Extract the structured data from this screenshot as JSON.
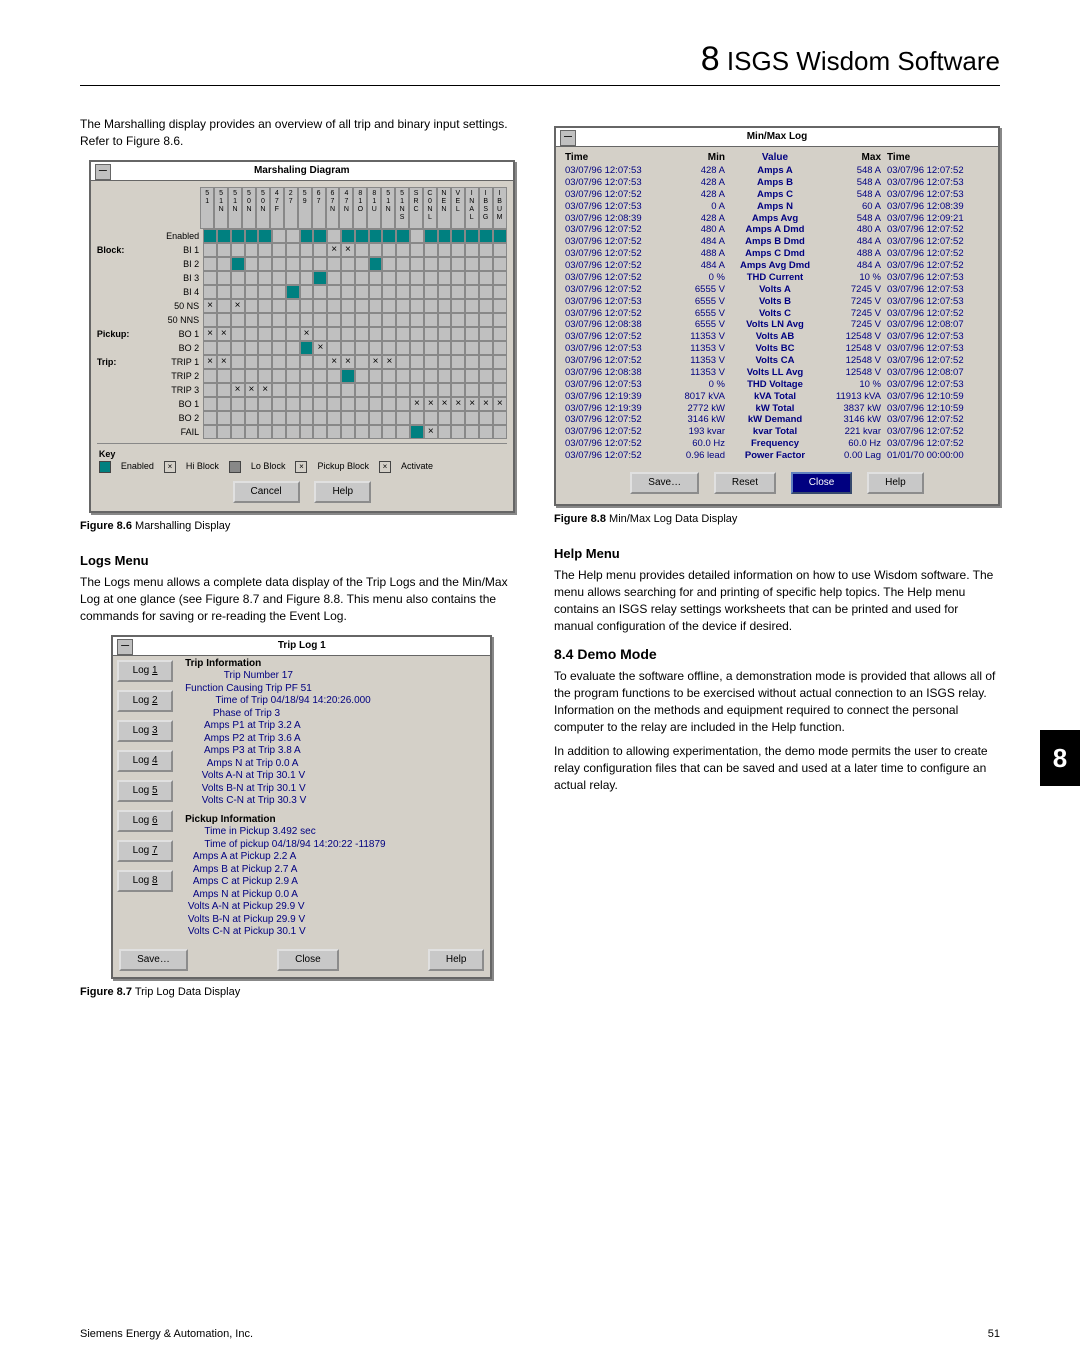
{
  "chapter": {
    "num": "8",
    "title": "ISGS Wisdom Software"
  },
  "side_tab": "8",
  "left": {
    "intro": "The Marshalling display provides an overview of all trip and binary input settings. Refer to Figure 8.6.",
    "marsh_caption_b": "Figure 8.6",
    "marsh_caption": "Marshalling Display",
    "marsh_dialog_title": "Marshaling Diagram",
    "marsh_col_headers": [
      "5 1",
      "5 1 N",
      "5 1 N",
      "5 0 N",
      "5 0 N",
      "4 7 F",
      "2 7",
      "5 9",
      "6 7",
      "6 7 N",
      "4 7 N",
      "8 1 O",
      "8 1 U",
      "5 1 N",
      "5 1 N S",
      "S R C",
      "C 0 N L",
      "N E N",
      "V E L",
      "I N A L",
      "I B S G",
      "I B U M"
    ],
    "marsh_sections": [
      {
        "label": "",
        "rows": [
          {
            "name": "Enabled",
            "cells": [
              1,
              1,
              1,
              1,
              1,
              0,
              0,
              1,
              1,
              0,
              1,
              1,
              1,
              1,
              1,
              0,
              1,
              1,
              1,
              1,
              1,
              1
            ]
          }
        ]
      },
      {
        "label": "Block:",
        "rows": [
          {
            "name": "BI 1",
            "cells": [
              0,
              0,
              0,
              0,
              0,
              0,
              0,
              0,
              0,
              2,
              2,
              0,
              0,
              0,
              0,
              0,
              0,
              0,
              0,
              0,
              0,
              0
            ]
          },
          {
            "name": "BI 2",
            "cells": [
              0,
              0,
              1,
              0,
              0,
              0,
              0,
              0,
              0,
              0,
              0,
              0,
              1,
              0,
              0,
              0,
              0,
              0,
              0,
              0,
              0,
              0
            ]
          },
          {
            "name": "BI 3",
            "cells": [
              0,
              0,
              0,
              0,
              0,
              0,
              0,
              0,
              1,
              0,
              0,
              0,
              0,
              0,
              0,
              0,
              0,
              0,
              0,
              0,
              0,
              0
            ]
          },
          {
            "name": "BI 4",
            "cells": [
              0,
              0,
              0,
              0,
              0,
              0,
              1,
              0,
              0,
              0,
              0,
              0,
              0,
              0,
              0,
              0,
              0,
              0,
              0,
              0,
              0,
              0
            ]
          },
          {
            "name": "50 NS",
            "cells": [
              2,
              0,
              2,
              0,
              0,
              0,
              0,
              0,
              0,
              0,
              0,
              0,
              0,
              0,
              0,
              0,
              0,
              0,
              0,
              0,
              0,
              0
            ]
          },
          {
            "name": "50 NNS",
            "cells": [
              0,
              0,
              0,
              0,
              0,
              0,
              0,
              0,
              0,
              0,
              0,
              0,
              0,
              0,
              0,
              0,
              0,
              0,
              0,
              0,
              0,
              0
            ]
          }
        ]
      },
      {
        "label": "Pickup:",
        "rows": [
          {
            "name": "BO 1",
            "cells": [
              2,
              2,
              0,
              0,
              0,
              0,
              0,
              2,
              0,
              0,
              0,
              0,
              0,
              0,
              0,
              0,
              0,
              0,
              0,
              0,
              0,
              0
            ]
          },
          {
            "name": "BO 2",
            "cells": [
              0,
              0,
              0,
              0,
              0,
              0,
              0,
              1,
              2,
              0,
              0,
              0,
              0,
              0,
              0,
              0,
              0,
              0,
              0,
              0,
              0,
              0
            ]
          }
        ]
      },
      {
        "label": "Trip:",
        "rows": [
          {
            "name": "TRIP 1",
            "cells": [
              2,
              2,
              0,
              0,
              0,
              0,
              0,
              0,
              0,
              2,
              2,
              0,
              2,
              2,
              0,
              0,
              0,
              0,
              0,
              0,
              0,
              0
            ]
          },
          {
            "name": "TRIP 2",
            "cells": [
              0,
              0,
              0,
              0,
              0,
              0,
              0,
              0,
              0,
              0,
              1,
              0,
              0,
              0,
              0,
              0,
              0,
              0,
              0,
              0,
              0,
              0
            ]
          },
          {
            "name": "TRIP 3",
            "cells": [
              0,
              0,
              2,
              2,
              2,
              0,
              0,
              0,
              0,
              0,
              0,
              0,
              0,
              0,
              0,
              0,
              0,
              0,
              0,
              0,
              0,
              0
            ]
          },
          {
            "name": "BO 1",
            "cells": [
              0,
              0,
              0,
              0,
              0,
              0,
              0,
              0,
              0,
              0,
              0,
              0,
              0,
              0,
              0,
              2,
              2,
              2,
              2,
              2,
              2,
              2
            ]
          },
          {
            "name": "BO 2",
            "cells": [
              0,
              0,
              0,
              0,
              0,
              0,
              0,
              0,
              0,
              0,
              0,
              0,
              0,
              0,
              0,
              0,
              0,
              0,
              0,
              0,
              0,
              0
            ]
          },
          {
            "name": "FAIL",
            "cells": [
              0,
              0,
              0,
              0,
              0,
              0,
              0,
              0,
              0,
              0,
              0,
              0,
              0,
              0,
              0,
              1,
              2,
              0,
              0,
              0,
              0,
              0
            ]
          }
        ]
      }
    ],
    "marsh_key_items": [
      "= Enabled",
      "× Hi Block",
      "= Lo Block",
      "× Pickup Block",
      "× Activate"
    ],
    "marsh_key_label": "Key",
    "marsh_btn_cancel": "Cancel",
    "marsh_btn_help": "Help",
    "logs_h": "Logs Menu",
    "logs_p": "The Logs menu allows a complete data display of the Trip Logs and the Min/Max Log at one glance (see Figure 8.7 and Figure 8.8. This menu also contains the commands for saving or re-reading the Event Log.",
    "triplog_title": "Trip Log 1",
    "triplog_buttons": [
      "Log 1",
      "Log 2",
      "Log 3",
      "Log 4",
      "Log 5",
      "Log 6",
      "Log 7",
      "Log 8"
    ],
    "triplog_group1_title": "Trip Information",
    "triplog_group1_lines": [
      "              Trip Number 17",
      "Function Causing Trip PF 51",
      "           Time of Trip 04/18/94 14:20:26.000",
      "          Phase of Trip 3",
      "       Amps P1 at Trip 3.2 A",
      "       Amps P2 at Trip 3.6 A",
      "       Amps P3 at Trip 3.8 A",
      "        Amps N at Trip 0.0 A",
      "      Volts A-N at Trip 30.1 V",
      "      Volts B-N at Trip 30.1 V",
      "      Volts C-N at Trip 30.3 V"
    ],
    "triplog_group2_title": "Pickup Information",
    "triplog_group2_lines": [
      "       Time in Pickup 3.492 sec",
      "       Time of pickup 04/18/94 14:20:22 -11879",
      "   Amps A at Pickup 2.2 A",
      "   Amps B at Pickup 2.7 A",
      "   Amps C at Pickup 2.9 A",
      "   Amps N at Pickup 0.0 A",
      " Volts A-N at Pickup 29.9 V",
      " Volts B-N at Pickup 29.9 V",
      " Volts C-N at Pickup 30.1 V"
    ],
    "triplog_btn_save": "Save…",
    "triplog_btn_close": "Close",
    "triplog_btn_help": "Help",
    "triplog_caption_b": "Figure 8.7",
    "triplog_caption": "Trip Log Data Display"
  },
  "right": {
    "mm_title": "Min/Max Log",
    "mm_headers": [
      "Time",
      "Min",
      "Value",
      "Max",
      "Time"
    ],
    "mm_rows": [
      [
        "03/07/96 12:07:53",
        "428 A",
        "Amps A",
        "548 A",
        "03/07/96 12:07:52"
      ],
      [
        "03/07/96 12:07:53",
        "428 A",
        "Amps B",
        "548 A",
        "03/07/96 12:07:53"
      ],
      [
        "03/07/96 12:07:52",
        "428 A",
        "Amps C",
        "548 A",
        "03/07/96 12:07:53"
      ],
      [
        "03/07/96 12:07:53",
        "0 A",
        "Amps N",
        "60 A",
        "03/07/96 12:08:39"
      ],
      [
        "03/07/96 12:08:39",
        "428 A",
        "Amps Avg",
        "548 A",
        "03/07/96 12:09:21"
      ],
      [
        "03/07/96 12:07:52",
        "480 A",
        "Amps A Dmd",
        "480 A",
        "03/07/96 12:07:52"
      ],
      [
        "03/07/96 12:07:52",
        "484 A",
        "Amps B Dmd",
        "484 A",
        "03/07/96 12:07:52"
      ],
      [
        "03/07/96 12:07:52",
        "488 A",
        "Amps C Dmd",
        "488 A",
        "03/07/96 12:07:52"
      ],
      [
        "03/07/96 12:07:52",
        "484 A",
        "Amps Avg Dmd",
        "484 A",
        "03/07/96 12:07:52"
      ],
      [
        "03/07/96 12:07:52",
        "0 %",
        "THD Current",
        "10 %",
        "03/07/96 12:07:53"
      ],
      [
        "03/07/96 12:07:52",
        "6555 V",
        "Volts A",
        "7245 V",
        "03/07/96 12:07:53"
      ],
      [
        "03/07/96 12:07:53",
        "6555 V",
        "Volts B",
        "7245 V",
        "03/07/96 12:07:53"
      ],
      [
        "03/07/96 12:07:52",
        "6555 V",
        "Volts C",
        "7245 V",
        "03/07/96 12:07:52"
      ],
      [
        "03/07/96 12:08:38",
        "6555 V",
        "Volts LN Avg",
        "7245 V",
        "03/07/96 12:08:07"
      ],
      [
        "03/07/96 12:07:52",
        "11353 V",
        "Volts AB",
        "12548 V",
        "03/07/96 12:07:53"
      ],
      [
        "03/07/96 12:07:53",
        "11353 V",
        "Volts BC",
        "12548 V",
        "03/07/96 12:07:53"
      ],
      [
        "03/07/96 12:07:52",
        "11353 V",
        "Volts CA",
        "12548 V",
        "03/07/96 12:07:52"
      ],
      [
        "03/07/96 12:08:38",
        "11353 V",
        "Volts LL Avg",
        "12548 V",
        "03/07/96 12:08:07"
      ],
      [
        "03/07/96 12:07:53",
        "0 %",
        "THD Voltage",
        "10 %",
        "03/07/96 12:07:53"
      ],
      [
        "03/07/96 12:19:39",
        "8017 kVA",
        "kVA Total",
        "11913 kVA",
        "03/07/96 12:10:59"
      ],
      [
        "03/07/96 12:19:39",
        "2772 kW",
        "kW Total",
        "3837 kW",
        "03/07/96 12:10:59"
      ],
      [
        "03/07/96 12:07:52",
        "3146 kW",
        "kW Demand",
        "3146 kW",
        "03/07/96 12:07:52"
      ],
      [
        "03/07/96 12:07:52",
        "193 kvar",
        "kvar Total",
        "221 kvar",
        "03/07/96 12:07:52"
      ],
      [
        "03/07/96 12:07:52",
        "60.0 Hz",
        "Frequency",
        "60.0 Hz",
        "03/07/96 12:07:52"
      ],
      [
        "03/07/96 12:07:52",
        "0.96 lead",
        "Power Factor",
        "0.00 Lag",
        "01/01/70 00:00:00"
      ]
    ],
    "mm_btn_save": "Save…",
    "mm_btn_reset": "Reset",
    "mm_btn_close": "Close",
    "mm_btn_help": "Help",
    "mm_caption_b": "Figure 8.8",
    "mm_caption": "Min/Max Log Data Display",
    "help_h": "Help Menu",
    "help_p": "The Help menu provides detailed information on how to use Wisdom software. The menu allows searching for and printing of specific help topics. The Help menu contains an ISGS relay settings worksheets that can be printed and used for manual configuration of the device if desired.",
    "sec84_h": "8.4  Demo Mode",
    "sec84_p1": "To evaluate the software offline, a demonstration mode is provided that allows all of the program functions to be exercised without actual connection to an ISGS relay. Information on the methods and equipment required to connect the personal computer to the relay are included in the Help function.",
    "sec84_p2": "In addition to allowing experimentation, the demo mode permits the user to create relay configuration files that can be saved and used at a later time to configure an actual relay."
  },
  "footer_left": "Siemens Energy & Automation, Inc.",
  "footer_right": "51"
}
